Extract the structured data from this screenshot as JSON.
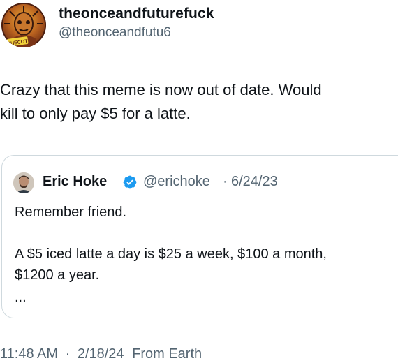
{
  "author": {
    "display_name": "theonceandfuturefuck",
    "handle": "@theonceandfutu6",
    "avatar_text": "THECOT"
  },
  "tweet": {
    "text": "Crazy that this meme is now out of date. Would\nkill to only pay $5 for a latte."
  },
  "quoted_tweet": {
    "display_name": "Eric Hoke",
    "handle": "@erichoke",
    "separator": "·",
    "date": "6/24/23",
    "text": "Remember friend.\n\nA $5 iced latte a day is $25 a week, $100 a month,\n$1200 a year.",
    "ellipsis": "...",
    "verified_icon": "verified-badge-icon",
    "verified_color": "#1d9bf0"
  },
  "footer": {
    "time": "11:48 AM",
    "separator": "·",
    "date": "2/18/24",
    "source": "From Earth"
  }
}
